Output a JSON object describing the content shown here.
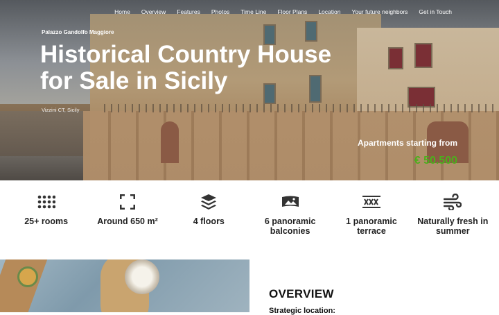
{
  "nav": {
    "items": [
      "Home",
      "Overview",
      "Features",
      "Photos",
      "Time Line",
      "Floor Plans",
      "Location",
      "Your future neighbors",
      "Get in Touch"
    ]
  },
  "hero": {
    "eyebrow": "Palazzo Gandolfo Maggiore",
    "title": "Historical Country House for Sale in Sicily",
    "location": "Vizzini CT, Sicily",
    "apartments_label": "Apartments starting from",
    "price": "€ 50.500",
    "price_color": "#4caf1c"
  },
  "features": [
    {
      "icon": "grid-dots-icon",
      "label": "25+ rooms"
    },
    {
      "icon": "expand-corners-icon",
      "label": "Around 650 m²"
    },
    {
      "icon": "layers-icon",
      "label": "4 floors"
    },
    {
      "icon": "panorama-icon",
      "label": "6 panoramic balconies"
    },
    {
      "icon": "terrace-icon",
      "label": "1 panoramic terrace"
    },
    {
      "icon": "wind-icon",
      "label": "Naturally fresh in summer"
    }
  ],
  "overview": {
    "heading": "OVERVIEW",
    "subheading": "Strategic location:"
  }
}
